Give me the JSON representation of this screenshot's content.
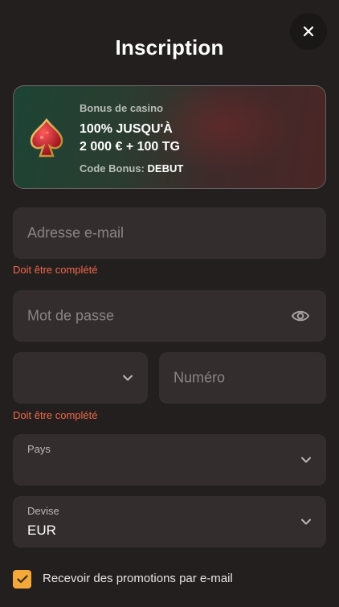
{
  "header": {
    "title": "Inscription",
    "close_icon": "close-icon"
  },
  "bonus": {
    "label": "Bonus de casino",
    "amount_line1": "100% JUSQU'À",
    "amount_line2": "2 000 € + 100 TG",
    "code_label": "Code Bonus:",
    "code_value": "DEBUT",
    "icon": "spade-icon"
  },
  "form": {
    "email": {
      "placeholder": "Adresse e-mail",
      "error": "Doit être complété"
    },
    "password": {
      "placeholder": "Mot de passe",
      "icon": "eye-icon"
    },
    "phone": {
      "code_value": "",
      "placeholder": "Numéro",
      "error": "Doit être complété"
    },
    "country": {
      "label": "Pays",
      "value": ""
    },
    "currency": {
      "label": "Devise",
      "value": "EUR"
    },
    "promo": {
      "label": "Recevoir des promotions par e-mail",
      "checked": true
    }
  },
  "colors": {
    "accent": "#f5a83a",
    "error": "#f0684a",
    "field_bg": "#332d2d",
    "page_bg": "#231f1f"
  }
}
